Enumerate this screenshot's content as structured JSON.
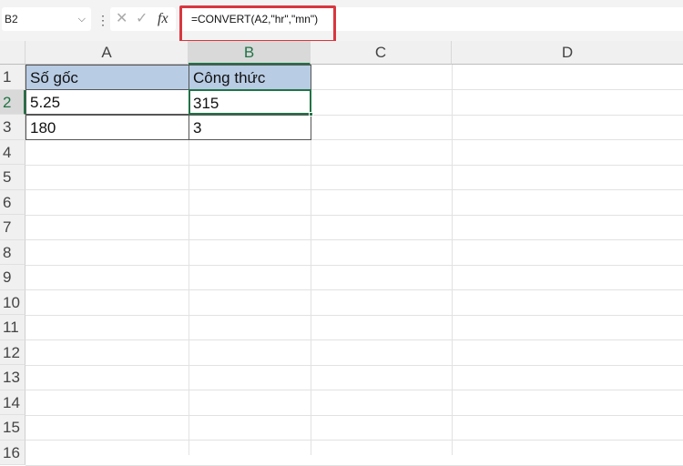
{
  "name_box": {
    "value": "B2"
  },
  "formula_bar": {
    "cancel_icon": "✕",
    "enter_icon": "✓",
    "fx_label": "fx",
    "formula": "=CONVERT(A2,\"hr\",\"mn\")"
  },
  "columns": [
    "A",
    "B",
    "C",
    "D"
  ],
  "rows": [
    "1",
    "2",
    "3",
    "4",
    "5",
    "6",
    "7",
    "8",
    "9",
    "10",
    "11",
    "12",
    "13",
    "14",
    "15",
    "16"
  ],
  "cells": {
    "A1": "Số gốc",
    "B1": "Công thức",
    "A2": "5.25",
    "B2": "315",
    "A3": "180",
    "B3": "3"
  },
  "colors": {
    "selection": "#217346",
    "header_fill": "#b8cce4",
    "highlight": "#d9363e"
  }
}
